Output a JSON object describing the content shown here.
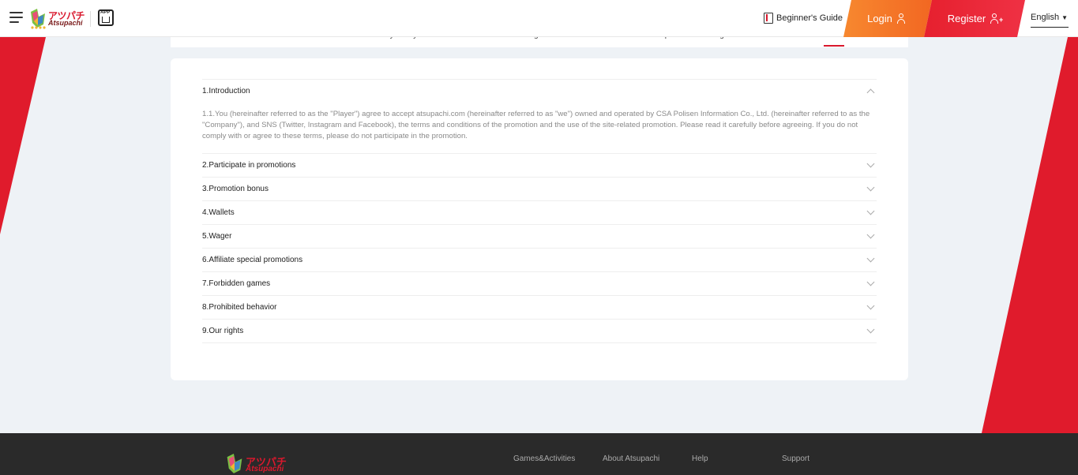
{
  "header": {
    "logo_text_jp": "アツパチ",
    "logo_text_en": "Atsupachi",
    "app_label": "APP",
    "beginners_guide": "Beginner's Guide",
    "login": "Login",
    "register": "Register",
    "language": "English"
  },
  "tabs": [
    {
      "label": "About Us"
    },
    {
      "label": "Privacy Policy"
    },
    {
      "label": "User Agreement"
    },
    {
      "label": "Responsible Gaming"
    },
    {
      "label": "Promotion Terms and Conditions"
    }
  ],
  "accordion": [
    {
      "title": "1.Introduction",
      "expanded": true,
      "body": "1.1.You (hereinafter referred to as the \"Player\") agree to accept atsupachi.com (hereinafter referred to as \"we\") owned and operated by CSA Polisen Information Co., Ltd. (hereinafter referred to as the \"Company\"), and SNS (Twitter, Instagram and Facebook), the terms and conditions of the promotion and the use of the site-related promotion. Please read it carefully before agreeing. If you do not comply with or agree to these terms, please do not participate in the promotion."
    },
    {
      "title": "2.Participate in promotions"
    },
    {
      "title": "3.Promotion bonus"
    },
    {
      "title": "4.Wallets"
    },
    {
      "title": "5.Wager"
    },
    {
      "title": "6.Affiliate special promotions"
    },
    {
      "title": "7.Forbidden games"
    },
    {
      "title": "8.Prohibited behavior"
    },
    {
      "title": "9.Our rights"
    }
  ],
  "footer": {
    "logo_text_jp": "アツパチ",
    "logo_text_en": "Atsupachi",
    "links": [
      "Games&Activities",
      "About Atsupachi",
      "Help",
      "Support"
    ]
  },
  "colors": {
    "brand_red": "#d9182d",
    "login_orange": "#f26722",
    "register_red": "#e6202e",
    "footer_bg": "#2a2a2a",
    "page_bg": "#eef2f6"
  }
}
